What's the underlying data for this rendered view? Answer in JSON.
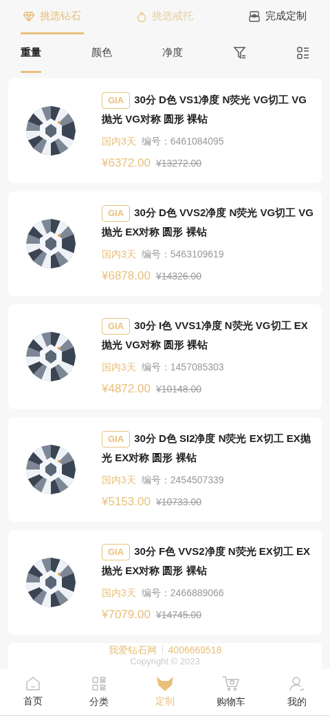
{
  "steps": [
    {
      "label": "挑选钻石",
      "selected": true
    },
    {
      "label": "挑选戒托",
      "selected": false
    },
    {
      "label": "完成定制",
      "selected": false
    }
  ],
  "sort_tabs": [
    {
      "kind": "text",
      "label": "重量",
      "selected": true
    },
    {
      "kind": "text",
      "label": "颜色",
      "selected": false
    },
    {
      "kind": "text",
      "label": "净度",
      "selected": false
    },
    {
      "kind": "filter",
      "selected": false
    },
    {
      "kind": "layout",
      "selected": false
    }
  ],
  "products": [
    {
      "badge": "GIA",
      "title": "30分 D色 VS1净度 N荧光 VG切工 VG抛光 VG对称 圆形 裸钻",
      "delivery": "国内3天",
      "code": "编号：6461084095",
      "price": "¥6372.00",
      "original_price": "¥13272.00"
    },
    {
      "badge": "GIA",
      "title": "30分 D色 VVS2净度 N荧光 VG切工 VG抛光 EX对称 圆形 裸钻",
      "delivery": "国内3天",
      "code": "编号：5463109619",
      "price": "¥6878.00",
      "original_price": "¥14326.00"
    },
    {
      "badge": "GIA",
      "title": "30分 I色 VVS1净度 N荧光 VG切工 EX抛光 VG对称 圆形 裸钻",
      "delivery": "国内3天",
      "code": "编号：1457085303",
      "price": "¥4872.00",
      "original_price": "¥10148.00"
    },
    {
      "badge": "GIA",
      "title": "30分 D色 SI2净度 N荧光 EX切工 EX抛光 EX对称 圆形 裸钻",
      "delivery": "国内3天",
      "code": "编号：2454507339",
      "price": "¥5153.00",
      "original_price": "¥10733.00"
    },
    {
      "badge": "GIA",
      "title": "30分 F色 VVS2净度 N荧光 EX切工 EX抛光 EX对称 圆形 裸钻",
      "delivery": "国内3天",
      "code": "编号：2466889066",
      "price": "¥7079.00",
      "original_price": "¥14745.00"
    }
  ],
  "footer": {
    "brand": "我爱钻石网",
    "phone": "4006669518",
    "copyright": "Copyright © 2023"
  },
  "tab_bar": [
    {
      "label": "首页",
      "selected": false
    },
    {
      "label": "分类",
      "selected": false
    },
    {
      "label": "定制",
      "selected": true
    },
    {
      "label": "购物车",
      "selected": false
    },
    {
      "label": "我的",
      "selected": false
    }
  ]
}
